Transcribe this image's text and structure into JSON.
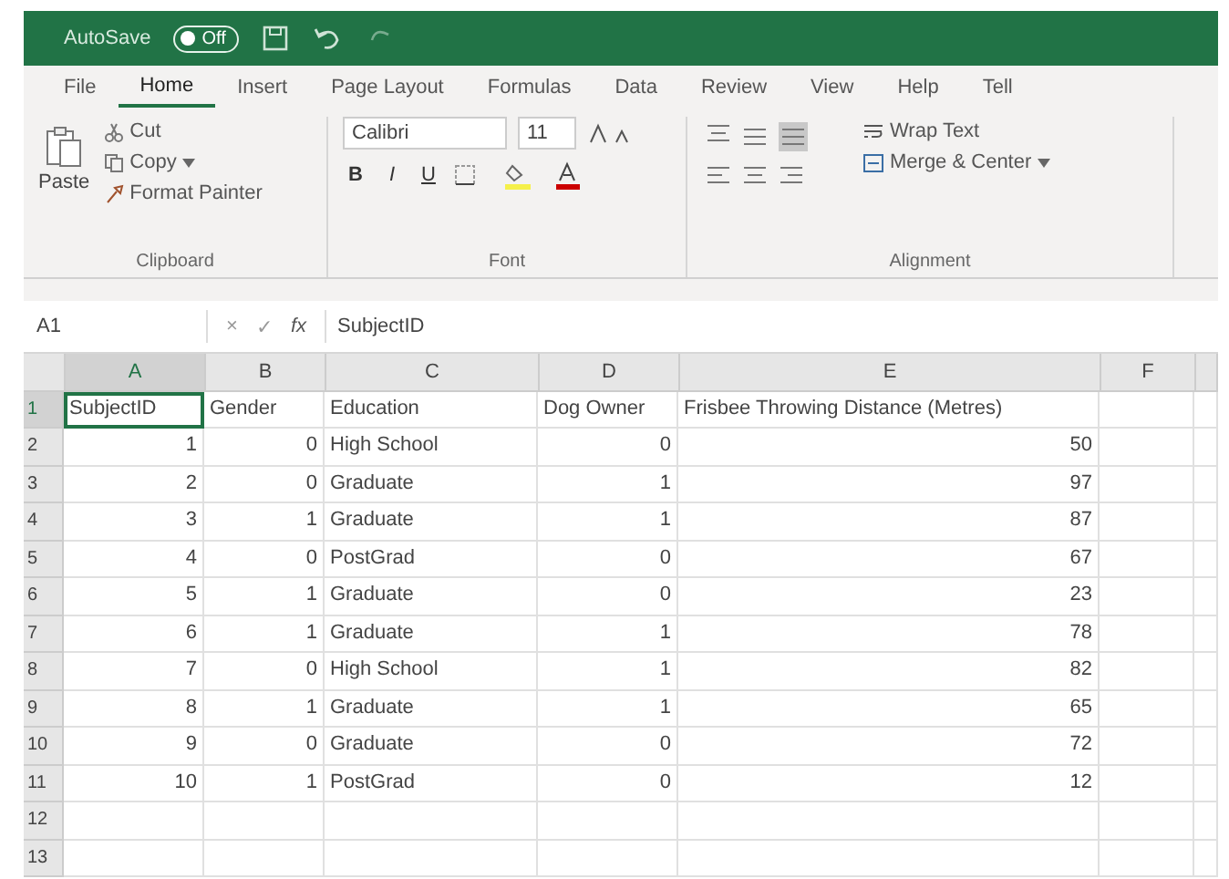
{
  "title_bar": {
    "autosave_label": "AutoSave",
    "autosave_on": false,
    "autosave_state": "Off"
  },
  "tabs": [
    {
      "label": "File",
      "selected": false
    },
    {
      "label": "Home",
      "selected": true
    },
    {
      "label": "Insert",
      "selected": false
    },
    {
      "label": "Page Layout",
      "selected": false
    },
    {
      "label": "Formulas",
      "selected": false
    },
    {
      "label": "Data",
      "selected": false
    },
    {
      "label": "Review",
      "selected": false
    },
    {
      "label": "View",
      "selected": false
    },
    {
      "label": "Help",
      "selected": false
    },
    {
      "label": "Tell",
      "selected": false
    }
  ],
  "ribbon": {
    "clipboard": {
      "paste": "Paste",
      "cut": "Cut",
      "copy": "Copy",
      "format_painter": "Format Painter",
      "label": "Clipboard"
    },
    "font": {
      "name": "Calibri",
      "size": "11",
      "bold": "B",
      "italic": "I",
      "underline": "U",
      "label": "Font"
    },
    "alignment": {
      "wrap": "Wrap Text",
      "merge": "Merge & Center",
      "label": "Alignment"
    }
  },
  "formula_bar": {
    "name_box": "A1",
    "cancel": "×",
    "enter": "✓",
    "fx": "fx",
    "value": "SubjectID"
  },
  "columns": [
    {
      "letter": "A",
      "kind": "number",
      "selected": true
    },
    {
      "letter": "B",
      "kind": "number",
      "selected": false
    },
    {
      "letter": "C",
      "kind": "text",
      "selected": false
    },
    {
      "letter": "D",
      "kind": "number",
      "selected": false
    },
    {
      "letter": "E",
      "kind": "number",
      "selected": false
    },
    {
      "letter": "F",
      "selected": false
    }
  ],
  "rows": [
    {
      "number": "1",
      "kind": "header",
      "selected": true,
      "cells": [
        "SubjectID",
        "Gender",
        "Education",
        "Dog Owner",
        "Frisbee Throwing Distance (Metres)"
      ]
    },
    {
      "number": "2",
      "kind": "data",
      "selected": false,
      "cells": [
        "1",
        "0",
        "High School",
        "0",
        "50"
      ]
    },
    {
      "number": "3",
      "kind": "data",
      "selected": false,
      "cells": [
        "2",
        "0",
        "Graduate",
        "1",
        "97"
      ]
    },
    {
      "number": "4",
      "kind": "data",
      "selected": false,
      "cells": [
        "3",
        "1",
        "Graduate",
        "1",
        "87"
      ]
    },
    {
      "number": "5",
      "kind": "data",
      "selected": false,
      "cells": [
        "4",
        "0",
        "PostGrad",
        "0",
        "67"
      ]
    },
    {
      "number": "6",
      "kind": "data",
      "selected": false,
      "cells": [
        "5",
        "1",
        "Graduate",
        "0",
        "23"
      ]
    },
    {
      "number": "7",
      "kind": "data",
      "selected": false,
      "cells": [
        "6",
        "1",
        "Graduate",
        "1",
        "78"
      ]
    },
    {
      "number": "8",
      "kind": "data",
      "selected": false,
      "cells": [
        "7",
        "0",
        "High School",
        "1",
        "82"
      ]
    },
    {
      "number": "9",
      "kind": "data",
      "selected": false,
      "cells": [
        "8",
        "1",
        "Graduate",
        "1",
        "65"
      ]
    },
    {
      "number": "10",
      "kind": "data",
      "selected": false,
      "cells": [
        "9",
        "0",
        "Graduate",
        "0",
        "72"
      ]
    },
    {
      "number": "11",
      "kind": "data",
      "selected": false,
      "cells": [
        "10",
        "1",
        "PostGrad",
        "0",
        "12"
      ]
    },
    {
      "number": "12",
      "kind": "empty",
      "selected": false
    },
    {
      "number": "13",
      "kind": "empty",
      "selected": false
    }
  ]
}
